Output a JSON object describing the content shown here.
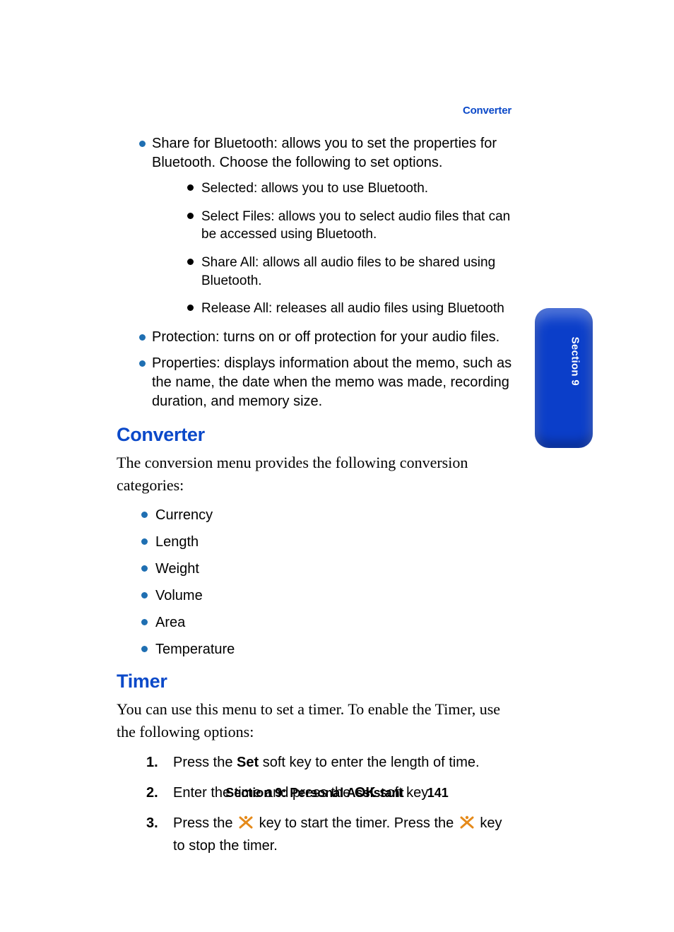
{
  "header": {
    "running_head": "Converter"
  },
  "upper_bullets": [
    {
      "text": "Share for Bluetooth: allows you to set the properties for Bluetooth. Choose the following to set options.",
      "sub": [
        "Selected: allows you to use Bluetooth.",
        "Select Files: allows you to select audio files that can be accessed using Bluetooth.",
        "Share All: allows all audio files to be shared using Bluetooth.",
        "Release All: releases all audio files using Bluetooth"
      ]
    },
    {
      "text": "Protection: turns on or off protection for your audio files."
    },
    {
      "text": "Properties: displays information about the memo, such as the name, the date when the memo was made, recording duration, and memory size."
    }
  ],
  "converter": {
    "heading": "Converter",
    "intro": "The conversion menu provides the following conversion categories:",
    "items": [
      "Currency",
      "Length",
      "Weight",
      "Volume",
      "Area",
      "Temperature"
    ]
  },
  "timer": {
    "heading": "Timer",
    "intro": "You can use this menu to set a timer. To enable the Timer, use the following options:",
    "steps": {
      "s1_a": "Press the ",
      "s1_bold": "Set",
      "s1_b": " soft key to enter the length of time.",
      "s2_a": "Enter the time and press the ",
      "s2_bold": "OK",
      "s2_b": " soft key.",
      "s3_a": "Press the ",
      "s3_b": " key to start the timer. Press the ",
      "s3_c": " key to stop the timer."
    }
  },
  "side_tab": {
    "label": "Section 9"
  },
  "footer": {
    "section": "Section 9: Personal Assistant",
    "page": "141"
  }
}
